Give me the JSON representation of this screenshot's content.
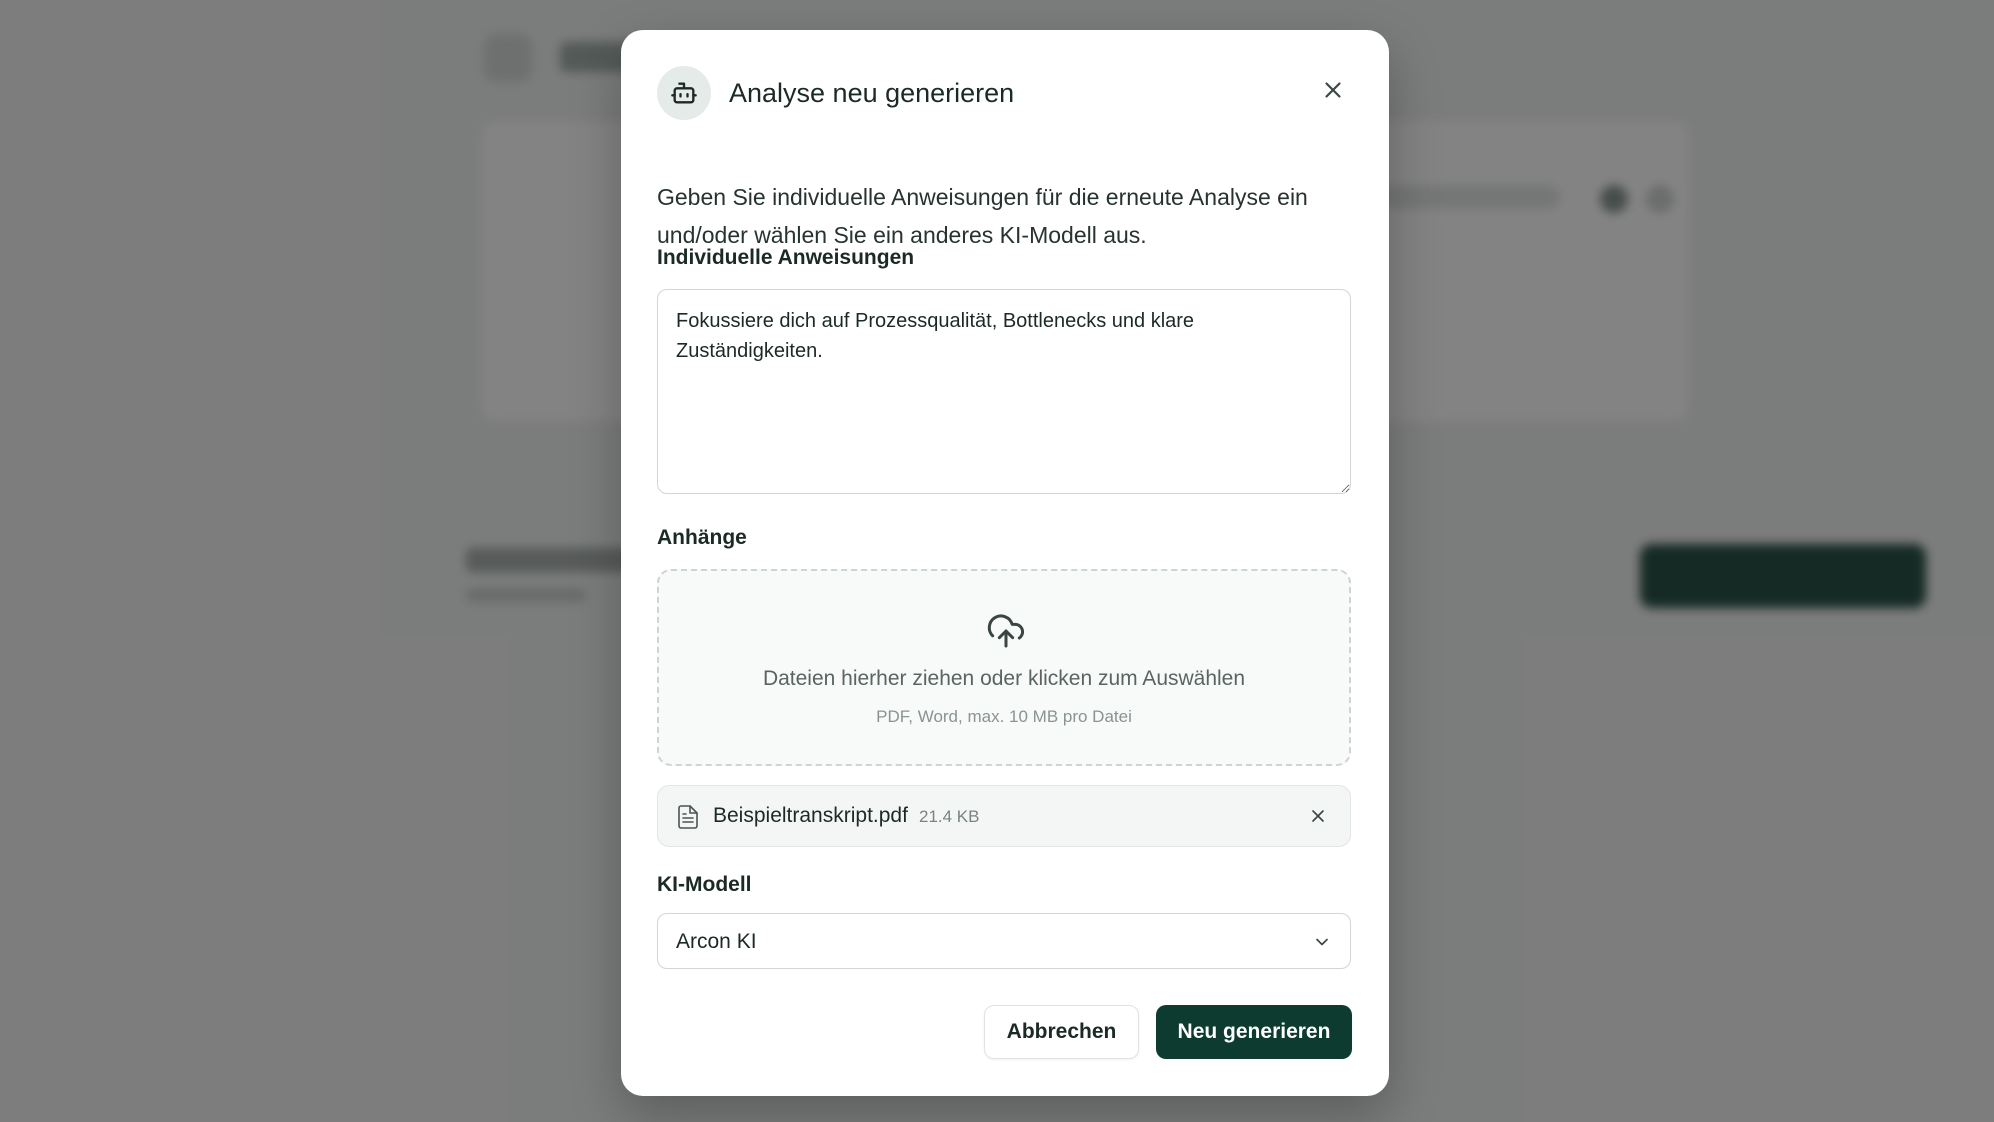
{
  "dialog": {
    "title": "Analyse neu generieren",
    "title_icon": "robot-icon",
    "close_icon": "close-icon",
    "description": "Geben Sie individuelle Anweisungen für die erneute Analyse ein und/oder wählen Sie ein anderes KI-Modell aus."
  },
  "instructions": {
    "label": "Individuelle Anweisungen",
    "value": "Fokussiere dich auf Prozessqualität, Bottlenecks und klare Zuständigkeiten."
  },
  "attachments": {
    "label": "Anhänge",
    "dropzone_icon": "cloud-upload-icon",
    "dropzone_text": "Dateien hierher ziehen oder klicken zum Auswählen",
    "dropzone_hint": "PDF, Word, max. 10 MB pro Datei",
    "files": [
      {
        "name": "Beispieltranskript.pdf",
        "size": "21.4 KB",
        "icon": "file-icon",
        "remove_icon": "close-icon"
      }
    ]
  },
  "model": {
    "label": "KI-Modell",
    "selected": "Arcon KI",
    "icon": "chevron-down-icon"
  },
  "actions": {
    "cancel_label": "Abbrechen",
    "submit_label": "Neu generieren"
  },
  "colors": {
    "primary": "#0e3b2f",
    "overlay": "rgba(30,30,30,0.55)",
    "badge_bg": "#e4ebe8"
  }
}
